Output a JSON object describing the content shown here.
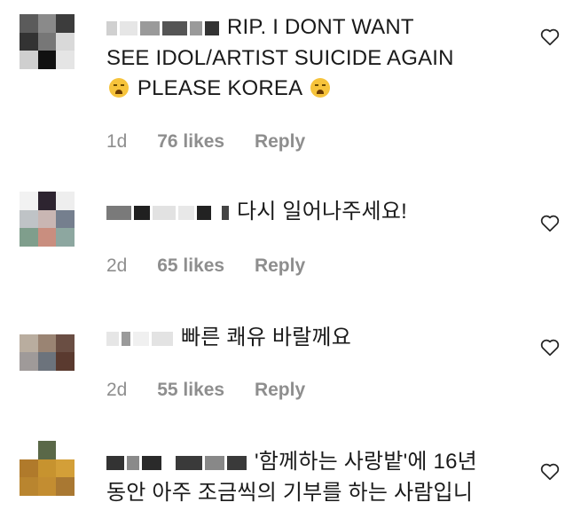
{
  "comments": [
    {
      "text_lines": [
        "RIP. I DONT WANT",
        "SEE IDOL/ARTIST SUICIDE AGAIN",
        "PLEASE KOREA"
      ],
      "time": "1d",
      "likes": "76 likes",
      "reply": "Reply",
      "avatar_colors": [
        "#5b5b5b",
        "#8a8a8a",
        "#3c3c3c",
        "#333333",
        "#777777",
        "#d9d9d9",
        "#cfcfcf",
        "#111111",
        "#e5e5e5"
      ]
    },
    {
      "text": "다시 일어나주세요!",
      "time": "2d",
      "likes": "65 likes",
      "reply": "Reply",
      "avatar_colors": [
        "#f2f2f2",
        "#2d2430",
        "#eeeeee",
        "#bfc3c6",
        "#c9b6b3",
        "#757f8e",
        "#7f9e8c",
        "#c98e7f",
        "#8da7a0"
      ]
    },
    {
      "text": "빠른 쾌유 바랄께요",
      "time": "2d",
      "likes": "55 likes",
      "reply": "Reply",
      "avatar_colors": [
        "#ffffff",
        "#ffffff",
        "#ffffff",
        "#b9ad9f",
        "#9a8473",
        "#6a4e43",
        "#9f9a99",
        "#6c737c",
        "#5a3a2f"
      ]
    },
    {
      "text_lines": [
        "'함께하는 사랑밭'에 16년",
        "동안 아주 조금씩의 기부를 하는 사람입니"
      ],
      "avatar_colors": [
        "#ffffff",
        "#5a6848",
        "#ffffff",
        "#b07a2b",
        "#c7932f",
        "#d39f38",
        "#b9852f",
        "#c38d31",
        "#a97832"
      ]
    }
  ],
  "icons": {
    "like": "heart-outline-icon",
    "emoji": "loudly-crying-face-icon"
  }
}
